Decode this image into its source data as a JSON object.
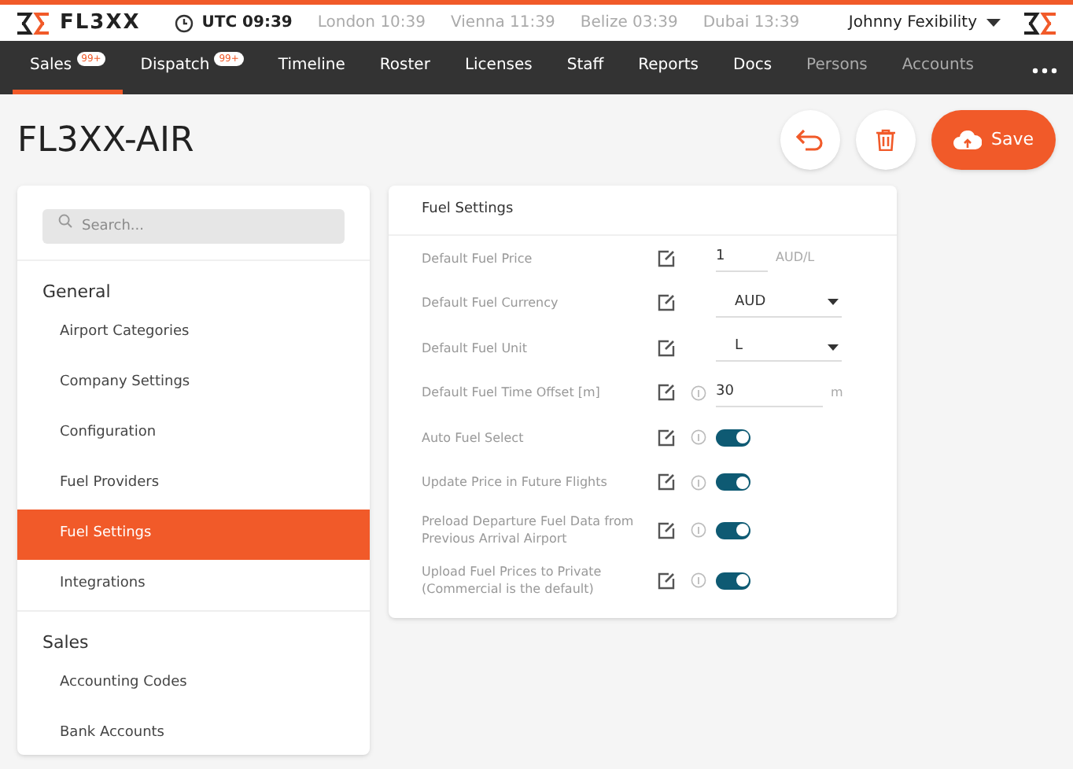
{
  "brand": "FL3XX",
  "clocks": [
    {
      "label": "UTC 09:39",
      "primary": true
    },
    {
      "label": "London 10:39",
      "primary": false
    },
    {
      "label": "Vienna 11:39",
      "primary": false
    },
    {
      "label": "Belize 03:39",
      "primary": false
    },
    {
      "label": "Dubai 13:39",
      "primary": false
    }
  ],
  "user": "Johnny Fexibility",
  "nav": [
    {
      "label": "Sales",
      "badge": "99+",
      "selected": true,
      "dimmed": false
    },
    {
      "label": "Dispatch",
      "badge": "99+",
      "selected": false,
      "dimmed": false
    },
    {
      "label": "Timeline",
      "selected": false,
      "dimmed": false
    },
    {
      "label": "Roster",
      "selected": false,
      "dimmed": false
    },
    {
      "label": "Licenses",
      "selected": false,
      "dimmed": false
    },
    {
      "label": "Staff",
      "selected": false,
      "dimmed": false
    },
    {
      "label": "Reports",
      "selected": false,
      "dimmed": false
    },
    {
      "label": "Docs",
      "selected": false,
      "dimmed": false
    },
    {
      "label": "Persons",
      "selected": false,
      "dimmed": true
    },
    {
      "label": "Accounts",
      "selected": false,
      "dimmed": true
    }
  ],
  "page_title": "FL3XX-AIR",
  "save_label": "Save",
  "sidebar": {
    "search_placeholder": "Search...",
    "sections": [
      {
        "title": "General",
        "items": [
          {
            "label": "Airport Categories",
            "selected": false
          },
          {
            "label": "Company Settings",
            "selected": false
          },
          {
            "label": "Configuration",
            "selected": false
          },
          {
            "label": "Fuel Providers",
            "selected": false
          },
          {
            "label": "Fuel Settings",
            "selected": true
          },
          {
            "label": "Integrations",
            "selected": false
          }
        ]
      },
      {
        "title": "Sales",
        "items": [
          {
            "label": "Accounting Codes",
            "selected": false
          },
          {
            "label": "Bank Accounts",
            "selected": false
          }
        ]
      }
    ]
  },
  "settings": {
    "title": "Fuel Settings",
    "rows": [
      {
        "kind": "input",
        "label": "Default Fuel Price",
        "info": false,
        "value": "1",
        "unit": "AUD/L"
      },
      {
        "kind": "select",
        "label": "Default Fuel Currency",
        "info": false,
        "value": "AUD"
      },
      {
        "kind": "select",
        "label": "Default Fuel Unit",
        "info": false,
        "value": "L"
      },
      {
        "kind": "input",
        "label": "Default Fuel Time Offset [m]",
        "info": true,
        "value": "30",
        "unit": "m"
      },
      {
        "kind": "toggle",
        "label": "Auto Fuel Select",
        "info": true,
        "on": true
      },
      {
        "kind": "toggle",
        "label": "Update Price in Future Flights",
        "info": true,
        "on": true
      },
      {
        "kind": "toggle",
        "label": "Preload Departure Fuel Data from Previous Arrival Airport",
        "info": true,
        "on": true
      },
      {
        "kind": "toggle",
        "label": "Upload Fuel Prices to Private (Commercial is the default)",
        "info": true,
        "on": true
      }
    ]
  }
}
